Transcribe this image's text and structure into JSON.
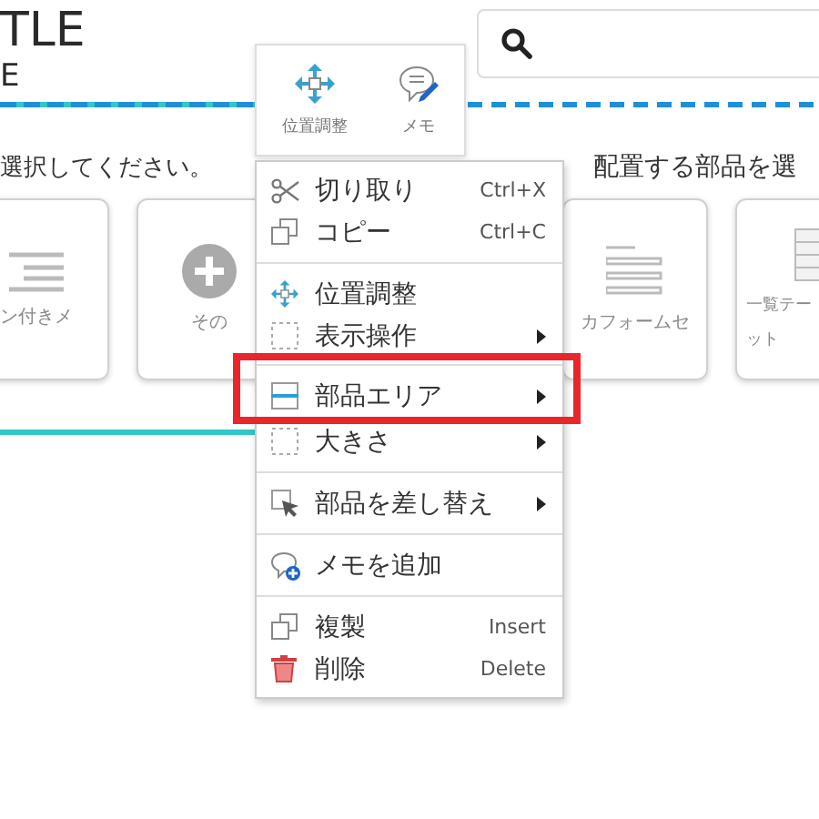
{
  "header": {
    "title": "TLE",
    "subtitle": "E"
  },
  "toolbar": {
    "buttons": [
      {
        "label": "位置調整"
      },
      {
        "label": "メモ"
      }
    ]
  },
  "sections": [
    {
      "prompt": "選択してください。",
      "cards": [
        {
          "label": "ン付きメ"
        },
        {
          "label": "その"
        }
      ]
    },
    {
      "prompt": "配置する部品を選",
      "cards": [
        {
          "label": "カフォームセ"
        },
        {
          "label": "一覧テー",
          "label_2": "ット"
        }
      ]
    }
  ],
  "context_menu": {
    "items": [
      {
        "label": "切り取り",
        "shortcut": "Ctrl+X",
        "submenu": false,
        "divider_before": false,
        "highlighted": false
      },
      {
        "label": "コピー",
        "shortcut": "Ctrl+C",
        "submenu": false,
        "divider_before": false,
        "highlighted": false
      },
      {
        "label": "位置調整",
        "submenu": false,
        "divider_before": true,
        "highlighted": false
      },
      {
        "label": "表示操作",
        "submenu": true,
        "divider_before": false,
        "highlighted": false
      },
      {
        "label": "部品エリア",
        "submenu": true,
        "divider_before": true,
        "highlighted": true
      },
      {
        "label": "大きさ",
        "submenu": true,
        "divider_before": false,
        "highlighted": false
      },
      {
        "label": "部品を差し替え",
        "submenu": true,
        "divider_before": true,
        "highlighted": false
      },
      {
        "label": "メモを追加",
        "submenu": false,
        "divider_before": true,
        "highlighted": false
      },
      {
        "label": "複製",
        "shortcut": "Insert",
        "submenu": false,
        "divider_before": true,
        "highlighted": false
      },
      {
        "label": "削除",
        "shortcut": "Delete",
        "submenu": false,
        "divider_before": false,
        "highlighted": false
      }
    ]
  }
}
